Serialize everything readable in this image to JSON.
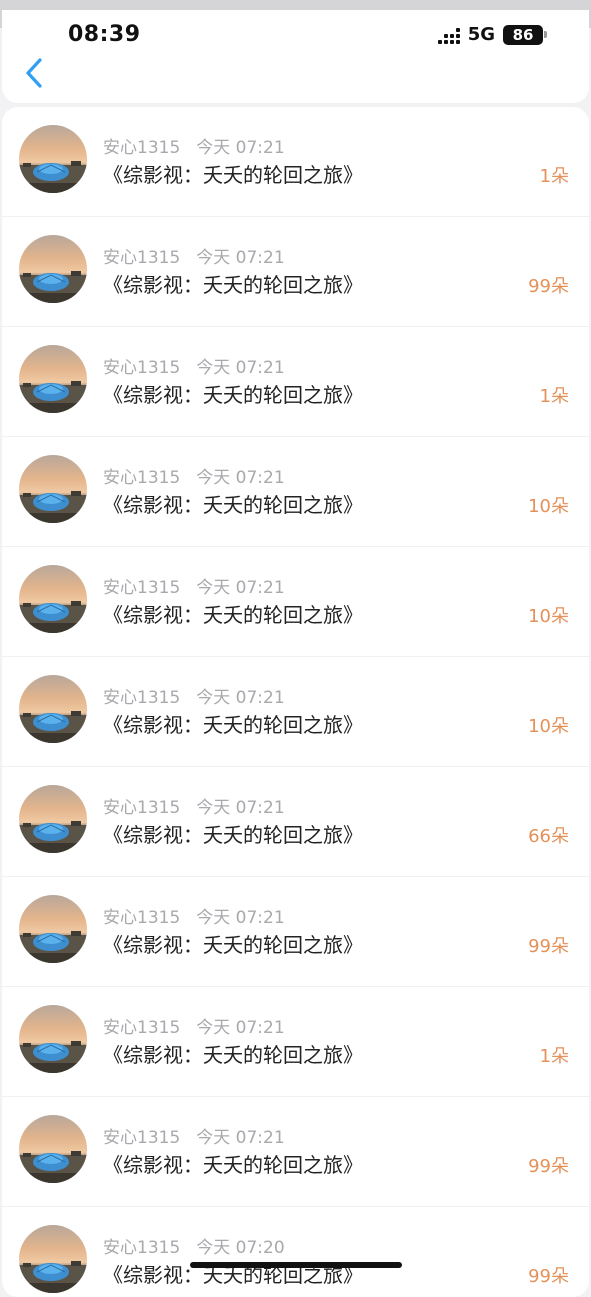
{
  "status_bar": {
    "time": "08:39",
    "network": "5G",
    "battery": "86"
  },
  "colors": {
    "accent": "#2f9ff3",
    "amount": "#e4915a",
    "meta": "#a9a9ad"
  },
  "rows": [
    {
      "user": "安心1315",
      "time": "今天 07:21",
      "title": "《综影视：夭夭的轮回之旅》",
      "amount": "1朵"
    },
    {
      "user": "安心1315",
      "time": "今天 07:21",
      "title": "《综影视：夭夭的轮回之旅》",
      "amount": "99朵"
    },
    {
      "user": "安心1315",
      "time": "今天 07:21",
      "title": "《综影视：夭夭的轮回之旅》",
      "amount": "1朵"
    },
    {
      "user": "安心1315",
      "time": "今天 07:21",
      "title": "《综影视：夭夭的轮回之旅》",
      "amount": "10朵"
    },
    {
      "user": "安心1315",
      "time": "今天 07:21",
      "title": "《综影视：夭夭的轮回之旅》",
      "amount": "10朵"
    },
    {
      "user": "安心1315",
      "time": "今天 07:21",
      "title": "《综影视：夭夭的轮回之旅》",
      "amount": "10朵"
    },
    {
      "user": "安心1315",
      "time": "今天 07:21",
      "title": "《综影视：夭夭的轮回之旅》",
      "amount": "66朵"
    },
    {
      "user": "安心1315",
      "time": "今天 07:21",
      "title": "《综影视：夭夭的轮回之旅》",
      "amount": "99朵"
    },
    {
      "user": "安心1315",
      "time": "今天 07:21",
      "title": "《综影视：夭夭的轮回之旅》",
      "amount": "1朵"
    },
    {
      "user": "安心1315",
      "time": "今天 07:21",
      "title": "《综影视：夭夭的轮回之旅》",
      "amount": "99朵"
    },
    {
      "user": "安心1315",
      "time": "今天 07:20",
      "title": "《综影视：夭夭的轮回之旅》",
      "amount": "99朵"
    }
  ]
}
